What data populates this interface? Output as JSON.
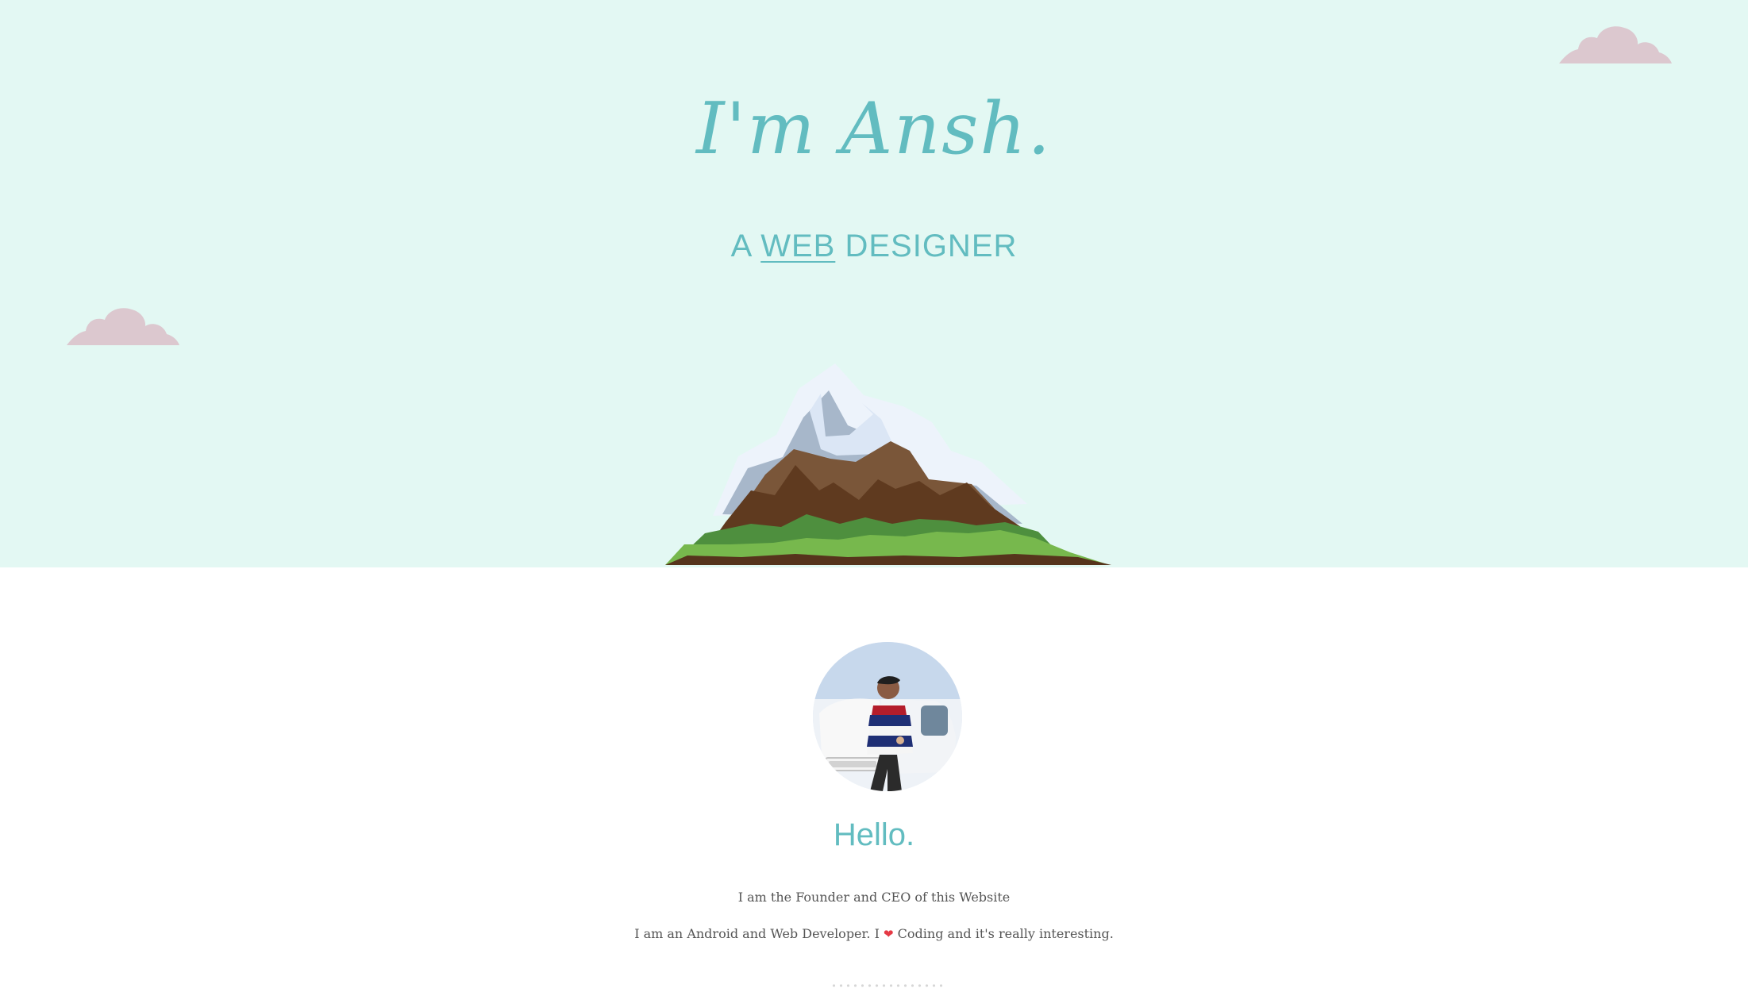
{
  "hero": {
    "title": "I'm Ansh.",
    "subtitle": {
      "prefix": "A",
      "highlight": "WEB",
      "suffix": "DESIGNER"
    },
    "background_color": "#e3f8f3",
    "accent_color": "#62bcc0",
    "cloud_color": "#dcc8cf"
  },
  "about": {
    "avatar_icon": "profile-photo",
    "heading": "Hello.",
    "line_1": "I am the Founder and CEO of this Website",
    "line_2_before": "I am an Android and Web Developer. I",
    "line_2_icon": "heart-icon",
    "line_2_heart": "❤",
    "line_2_after": "Coding and it's really interesting.",
    "text_color": "#555555",
    "heart_color": "#e53945"
  }
}
